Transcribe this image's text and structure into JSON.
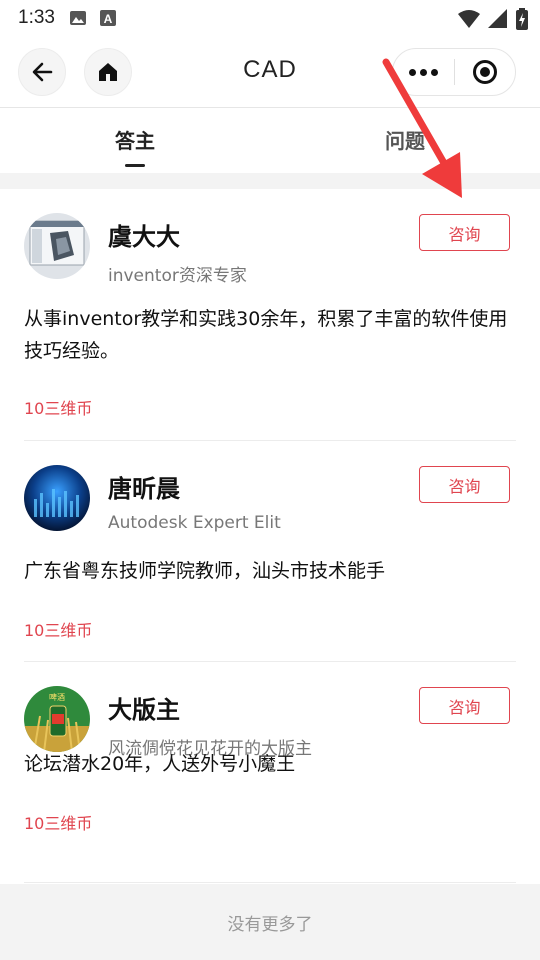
{
  "status_bar": {
    "time": "1:33",
    "left_icons": [
      "image-icon",
      "a-badge-icon"
    ],
    "right_icons": [
      "wifi-icon",
      "signal-icon",
      "battery-charging-icon"
    ]
  },
  "nav": {
    "title": "CAD",
    "back_icon": "arrow-left-icon",
    "home_icon": "home-icon",
    "menu_icon": "more-dots-icon",
    "close_icon": "target-circle-icon"
  },
  "tabs": [
    {
      "label": "答主",
      "active": true
    },
    {
      "label": "问题",
      "active": false
    }
  ],
  "experts": [
    {
      "name": "虞大大",
      "subtitle": "inventor资深专家",
      "button_label": "咨询",
      "description": "从事inventor教学和实践30余年，积累了丰富的软件使用技巧经验。",
      "price": "10三维币"
    },
    {
      "name": "唐昕晨",
      "subtitle": "Autodesk Expert Elit",
      "button_label": "咨询",
      "description": "广东省粤东技师学院教师，汕头市技术能手",
      "price": "10三维币"
    },
    {
      "name": "大版主",
      "subtitle": "风流倜傥花见花开的大版主",
      "button_label": "咨询",
      "description": "论坛潜水20年，人送外号小魔王",
      "price": "10三维币"
    }
  ],
  "footer": {
    "text": "没有更多了"
  },
  "colors": {
    "accent": "#e0454f",
    "annotation_arrow": "#ef3b3b"
  }
}
